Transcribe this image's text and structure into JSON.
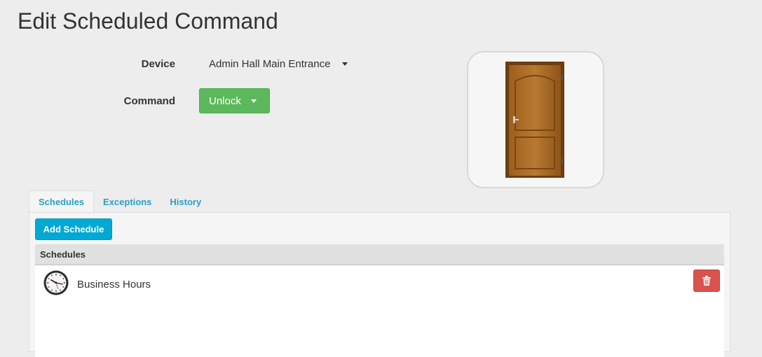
{
  "page": {
    "title": "Edit Scheduled Command"
  },
  "form": {
    "device_label": "Device",
    "device_value": "Admin Hall Main Entrance",
    "command_label": "Command",
    "command_value": "Unlock"
  },
  "tabs": [
    {
      "label": "Schedules",
      "active": true
    },
    {
      "label": "Exceptions",
      "active": false
    },
    {
      "label": "History",
      "active": false
    }
  ],
  "schedules": {
    "add_button_label": "Add Schedule",
    "table_header": "Schedules",
    "rows": [
      {
        "name": "Business Hours",
        "icon": "clock-icon",
        "action_icon": "trash-icon"
      }
    ]
  },
  "colors": {
    "command_button": "#5cb85c",
    "add_button": "#00a8d4",
    "delete_button": "#d9534f",
    "tab_link": "#2a9fc9"
  },
  "image": {
    "icon": "door-icon"
  }
}
